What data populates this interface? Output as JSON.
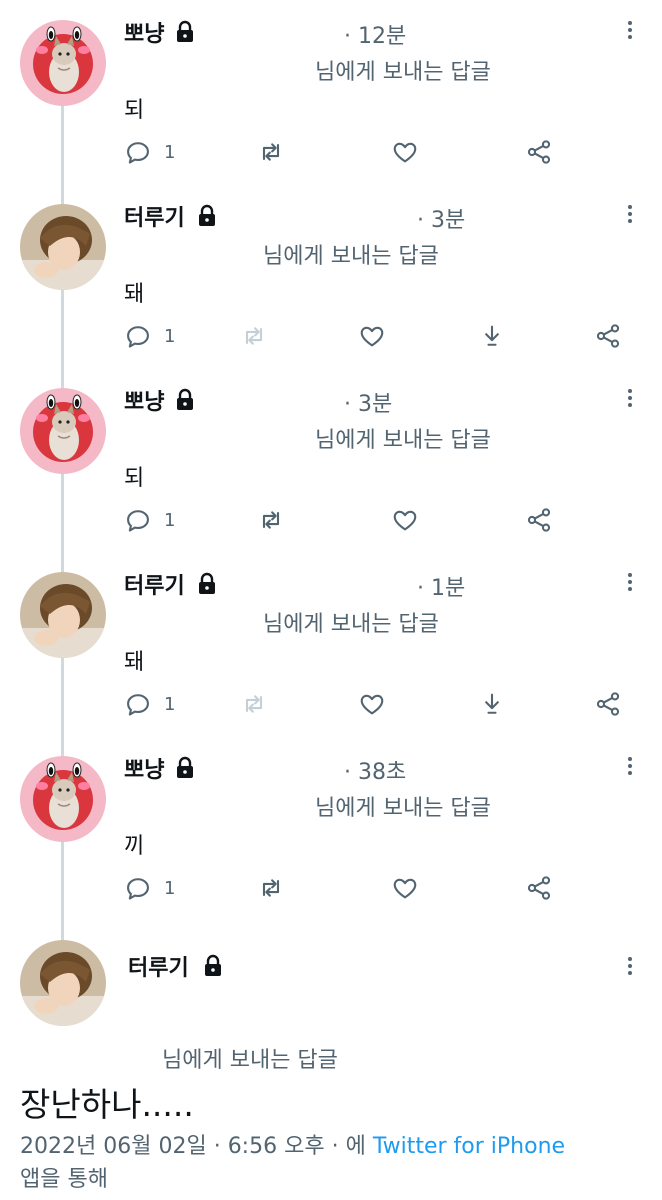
{
  "reply_label": "님에게 보내는 답글",
  "tweets": [
    {
      "name": "뽀냥",
      "time": "· 12분",
      "text": "되",
      "replies": "1",
      "avatar": "kitten-avatar",
      "has_download": false,
      "retweet_enabled": true
    },
    {
      "name": "터루기",
      "time": "· 3분",
      "text": "돼",
      "replies": "1",
      "avatar": "person-avatar",
      "has_download": true,
      "retweet_enabled": false
    },
    {
      "name": "뽀냥",
      "time": "· 3분",
      "text": "되",
      "replies": "1",
      "avatar": "kitten-avatar",
      "has_download": false,
      "retweet_enabled": true
    },
    {
      "name": "터루기",
      "time": "· 1분",
      "text": "돼",
      "replies": "1",
      "avatar": "person-avatar",
      "has_download": true,
      "retweet_enabled": false
    },
    {
      "name": "뽀냥",
      "time": "· 38초",
      "text": "끼",
      "replies": "1",
      "avatar": "kitten-avatar",
      "has_download": false,
      "retweet_enabled": true
    }
  ],
  "main_tweet": {
    "name": "터루기",
    "reply_label": "님에게 보내는 답글",
    "text": "장난하나.....",
    "date": "2022년 06월 02일",
    "separator": "·",
    "time": "6:56 오후",
    "via_prefix": "· 에",
    "app": "Twitter for iPhone",
    "via_suffix": "앱을 통해"
  },
  "colors": {
    "secondary": "#536471",
    "link": "#1d9bf0",
    "thread": "#cfd9de",
    "disabled": "#c4cfd6"
  }
}
